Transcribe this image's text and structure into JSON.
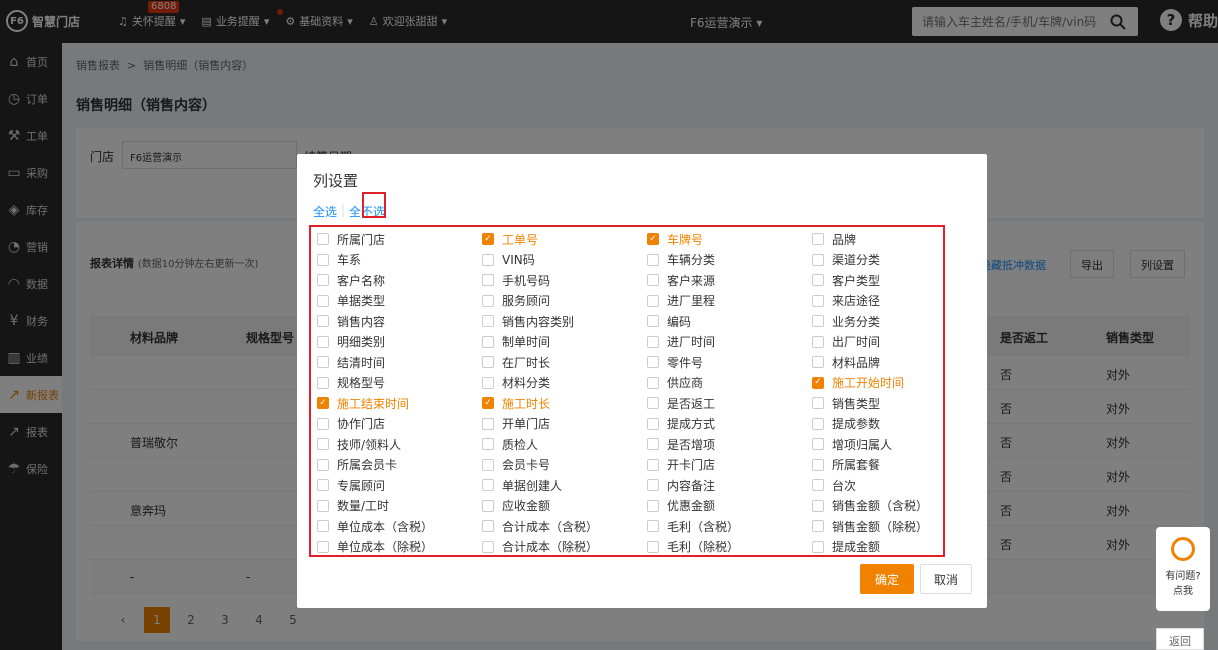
{
  "topbar": {
    "logo": "智慧门店",
    "nav": [
      {
        "icon": "bell-icon",
        "label": "关怀提醒",
        "badge": "6808"
      },
      {
        "icon": "doc-icon",
        "label": "业务提醒",
        "dot": true
      },
      {
        "icon": "gear-icon",
        "label": "基础资料"
      },
      {
        "icon": "user-icon",
        "label": "欢迎张甜甜"
      }
    ],
    "store": "F6运营演示",
    "search_placeholder": "请输入车主姓名/手机/车牌/vin码",
    "help": "帮助"
  },
  "sidebar": [
    {
      "icon": "home-icon",
      "label": "首页"
    },
    {
      "icon": "clock-icon",
      "label": "订单"
    },
    {
      "icon": "wrench-icon",
      "label": "工单"
    },
    {
      "icon": "cart-icon",
      "label": "采购"
    },
    {
      "icon": "box-icon",
      "label": "库存"
    },
    {
      "icon": "marketing-icon",
      "label": "营销"
    },
    {
      "icon": "cloud-icon",
      "label": "数据"
    },
    {
      "icon": "yen-icon",
      "label": "财务"
    },
    {
      "icon": "bar-icon",
      "label": "业绩"
    },
    {
      "icon": "report-icon",
      "label": "新报表",
      "active": true
    },
    {
      "icon": "report2-icon",
      "label": "报表"
    },
    {
      "icon": "umbrella-icon",
      "label": "保险"
    }
  ],
  "breadcrumb": [
    "销售报表",
    "销售明细（销售内容）"
  ],
  "page_title": "销售明细（销售内容）",
  "filter": {
    "store_label": "门店",
    "store_value": "F6运营演示",
    "date_label": "结算日期"
  },
  "table": {
    "title": "报表详情",
    "subtitle": "(数据10分钟左右更新一次)",
    "link": "隐藏抵冲数据",
    "export": "导出",
    "col_settings": "列设置",
    "headers_left": [
      "材料品牌",
      "规格型号"
    ],
    "headers_right": [
      "是否返工",
      "销售类型"
    ],
    "rows": [
      {
        "brand": "",
        "rework": "否",
        "type": "对外"
      },
      {
        "brand": "",
        "rework": "否",
        "type": "对外"
      },
      {
        "brand": "普瑞敬尔",
        "rework": "否",
        "type": "对外"
      },
      {
        "brand": "",
        "rework": "否",
        "type": "对外"
      },
      {
        "brand": "意奔玛",
        "rework": "否",
        "type": "对外"
      },
      {
        "brand": "",
        "rework": "否",
        "type": "对外"
      }
    ],
    "footer_dash": "-",
    "pages": [
      "1",
      "2",
      "3",
      "4",
      "5"
    ]
  },
  "float_help": {
    "line1": "有问题?",
    "line2": "点我"
  },
  "back": "返回",
  "modal": {
    "title": "列设置",
    "select_all": "全选",
    "select_none": "全不选",
    "ok": "确定",
    "cancel": "取消",
    "columns": [
      [
        "所属门店",
        "车系",
        "客户名称",
        "单据类型",
        "销售内容",
        "明细类别",
        "结清时间",
        "规格型号",
        "施工结束时间",
        "协作门店",
        "技师/领料人",
        "所属会员卡",
        "专属顾问",
        "数量/工时",
        "单位成本（含税）",
        "单位成本（除税）"
      ],
      [
        "工单号",
        "VIN码",
        "手机号码",
        "服务顾问",
        "销售内容类别",
        "制单时间",
        "在厂时长",
        "材料分类",
        "施工时长",
        "开单门店",
        "质检人",
        "会员卡号",
        "单据创建人",
        "应收金额",
        "合计成本（含税）",
        "合计成本（除税）"
      ],
      [
        "车牌号",
        "车辆分类",
        "客户来源",
        "进厂里程",
        "编码",
        "进厂时间",
        "零件号",
        "供应商",
        "是否返工",
        "提成方式",
        "是否增项",
        "开卡门店",
        "内容备注",
        "优惠金额",
        "毛利（含税）",
        "毛利（除税）"
      ],
      [
        "品牌",
        "渠道分类",
        "客户类型",
        "来店途径",
        "业务分类",
        "出厂时间",
        "材料品牌",
        "施工开始时间",
        "销售类型",
        "提成参数",
        "增项归属人",
        "所属套餐",
        "台次",
        "销售金额（含税）",
        "销售金额（除税）",
        "提成金额"
      ]
    ],
    "checked": [
      "工单号",
      "车牌号",
      "施工开始时间",
      "施工结束时间",
      "施工时长"
    ]
  }
}
